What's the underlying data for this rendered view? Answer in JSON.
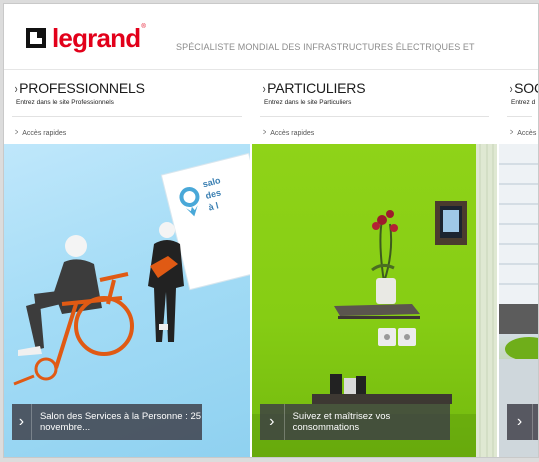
{
  "header": {
    "logo_text": "legrand",
    "logo_reg": "®",
    "tagline": "SPÉCIALISTE MONDIAL DES INFRASTRUCTURES ÉLECTRIQUES ET"
  },
  "columns": [
    {
      "chevron": "›",
      "title": "PROFESSIONNELS",
      "subtitle": "Entrez dans le site Professionnels",
      "quick_link": "Accès rapides",
      "caption": "Salon des Services à la Personne : 25 novembre..."
    },
    {
      "chevron": "›",
      "title": "PARTICULIERS",
      "subtitle": "Entrez dans le site Particuliers",
      "quick_link": "Accès rapides",
      "caption": "Suivez et maîtrisez vos consommations"
    },
    {
      "chevron": "›",
      "title": "SOC",
      "subtitle": "Entrez d",
      "quick_link": "Accès",
      "caption": ""
    }
  ],
  "poster": {
    "line1": "salo",
    "line2": "des",
    "line3": "à l"
  },
  "colors": {
    "brand_red": "#e2001a",
    "wall_green": "#86cd14",
    "sky_blue": "#a4dcf6",
    "wheelchair_orange": "#e05a14"
  }
}
